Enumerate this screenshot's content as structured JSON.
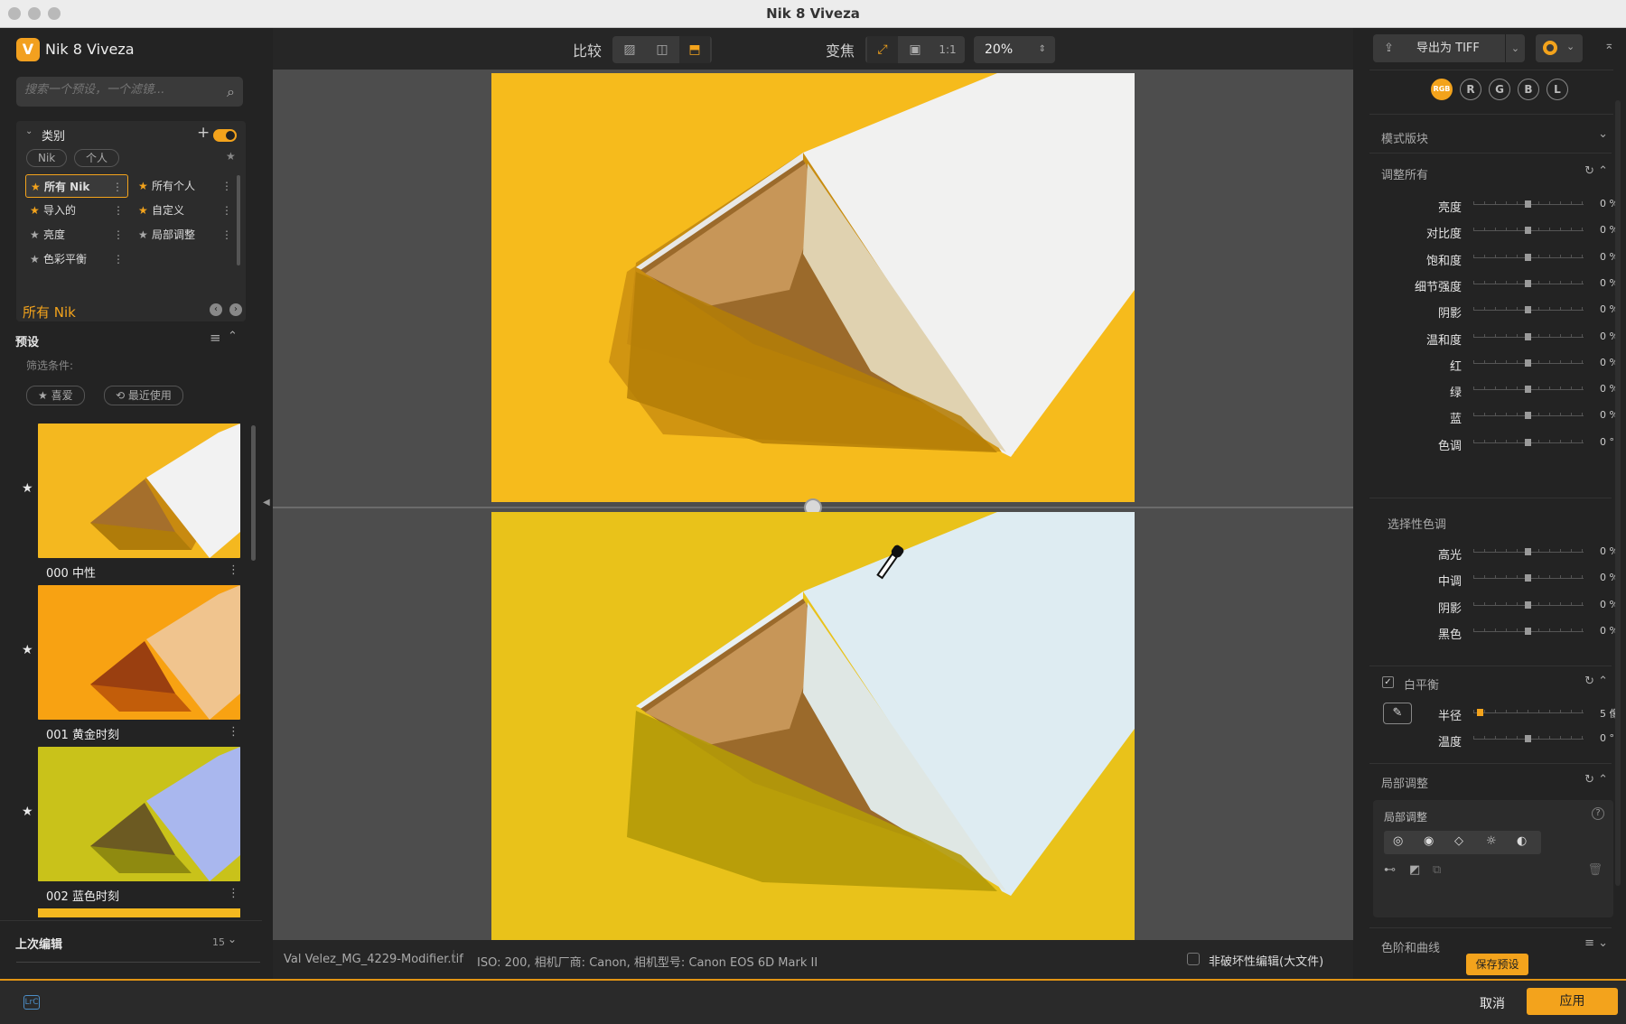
{
  "window": {
    "title": "Nik 8 Viveza"
  },
  "left": {
    "app_name": "Nik 8 Viveza",
    "search_placeholder": "搜索一个预设，一个滤镜...",
    "category_title": "类别",
    "pills": [
      "Nik",
      "个人"
    ],
    "categories": [
      {
        "label": "所有 Nik",
        "active": true
      },
      {
        "label": "所有个人",
        "active": false
      },
      {
        "label": "导入的",
        "active": false
      },
      {
        "label": "自定义",
        "active": false
      },
      {
        "label": "亮度",
        "active": false
      },
      {
        "label": "局部调整",
        "active": false
      },
      {
        "label": "色彩平衡",
        "active": false
      }
    ],
    "current_collection": "所有 Nik",
    "presets_title": "预设",
    "filter_label": "筛选条件:",
    "filter_buttons": [
      "喜爱",
      "最近使用"
    ],
    "presets": [
      {
        "label": "000 中性"
      },
      {
        "label": "001 黄金时刻"
      },
      {
        "label": "002 蓝色时刻"
      }
    ],
    "last_edit_title": "上次编辑",
    "last_edit_count": "15"
  },
  "toolbar": {
    "compare_label": "比较",
    "zoom_label": "变焦",
    "one_to_one": "1:1",
    "zoom_value": "20%"
  },
  "status": {
    "filename": "Val Velez_MG_4229-Modifier.tif",
    "exif": "ISO: 200, 相机厂商: Canon, 相机型号: Canon EOS 6D Mark II",
    "non_destructive": "非破坏性编辑(大文件)"
  },
  "right": {
    "export_label": "导出为 TIFF",
    "channels": [
      "RGB",
      "R",
      "G",
      "B",
      "L"
    ],
    "mode_block": "模式版块",
    "adjust_all": "调整所有",
    "sliders": [
      {
        "label": "亮度",
        "value": "0 %"
      },
      {
        "label": "对比度",
        "value": "0 %"
      },
      {
        "label": "饱和度",
        "value": "0 %"
      },
      {
        "label": "细节强度",
        "value": "0 %"
      },
      {
        "label": "阴影",
        "value": "0 %"
      },
      {
        "label": "温和度",
        "value": "0 %"
      },
      {
        "label": "红",
        "value": "0 %"
      },
      {
        "label": "绿",
        "value": "0 %"
      },
      {
        "label": "蓝",
        "value": "0 %"
      },
      {
        "label": "色调",
        "value": "0 °"
      }
    ],
    "selective_tone": "选择性色调",
    "tone_sliders": [
      {
        "label": "高光",
        "value": "0 %"
      },
      {
        "label": "中调",
        "value": "0 %"
      },
      {
        "label": "阴影",
        "value": "0 %"
      },
      {
        "label": "黑色",
        "value": "0 %"
      }
    ],
    "white_balance": "白平衡",
    "wb_sliders": [
      {
        "label": "半径",
        "value": "5 像"
      },
      {
        "label": "温度",
        "value": "0 °"
      }
    ],
    "local_adjust": "局部调整",
    "local_adjust_sub": "局部调整",
    "levels_curves": "色阶和曲线",
    "save_preset": "保存预设"
  },
  "bottom": {
    "lrc": "LrC",
    "cancel": "取消",
    "apply": "应用"
  },
  "colors": {
    "accent": "#f3a31c",
    "yellow": "#f4b81f",
    "paper": "#f2f2f2"
  }
}
